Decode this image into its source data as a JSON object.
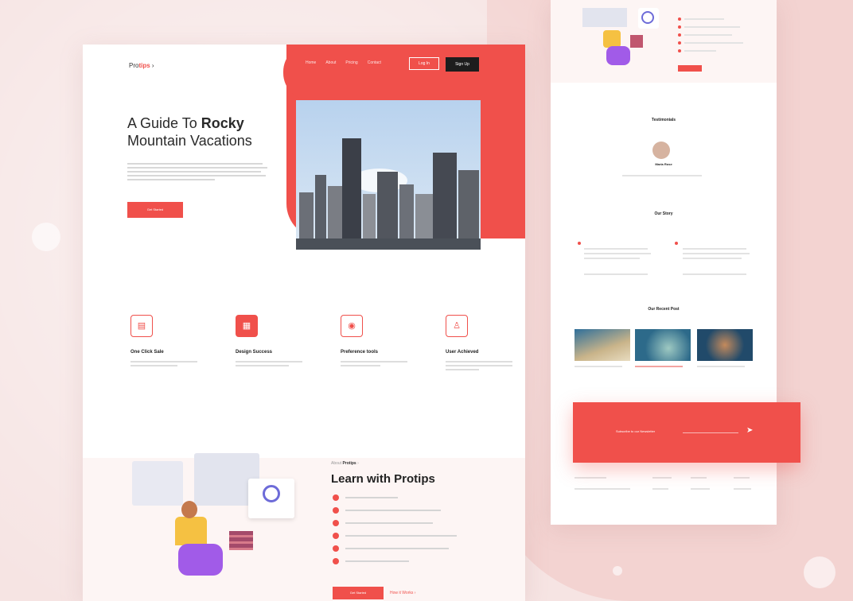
{
  "header": {
    "logo_prefix": "Pro",
    "logo_suffix": "tips",
    "nav": [
      "Home",
      "About",
      "Pricing",
      "Contact"
    ],
    "login_label": "Log In",
    "signup_label": "Sign Up"
  },
  "hero": {
    "title_plain": "A Guide To ",
    "title_bold": "Rocky",
    "title_line2": "Mountain Vacations",
    "cta_label": "Get Started"
  },
  "features": [
    {
      "icon": "document-icon",
      "glyph": "▤",
      "title": "One Click Sale"
    },
    {
      "icon": "grid-icon",
      "glyph": "▦",
      "title": "Design Success"
    },
    {
      "icon": "eye-icon",
      "glyph": "◉",
      "title": "Preference tools"
    },
    {
      "icon": "user-icon",
      "glyph": "♙",
      "title": "User Achieved"
    }
  ],
  "learn": {
    "eyebrow_prefix": "About ",
    "eyebrow_brand": "Protips",
    "title": "Learn with Protips",
    "cta_label": "Get Started",
    "link_label": "How it Works"
  },
  "side": {
    "testimonial_title": "Testimonials",
    "person_name": "Maria Rose",
    "story_title": "Our Story",
    "article_title": "Our Recent Post",
    "newsletter_title": "Subscribe to our Newsletter"
  },
  "colors": {
    "accent": "#f0504b",
    "dark": "#1d1d1d",
    "bg": "#f6e4e3"
  }
}
